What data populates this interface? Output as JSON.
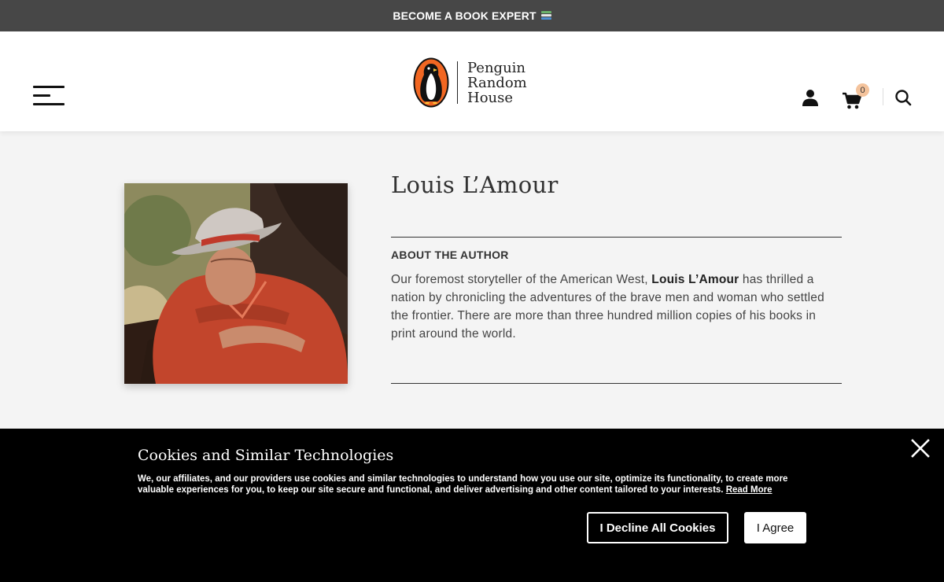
{
  "promo": {
    "text": "BECOME A BOOK EXPERT",
    "icon": "books-emoji-icon"
  },
  "header": {
    "logo_lines": [
      "Penguin",
      "Random",
      "House"
    ],
    "cart_count": "0",
    "colors": {
      "logo_orange": "#f26722",
      "badge": "#f4c39c"
    }
  },
  "author": {
    "name": "Louis L’Amour",
    "photo": "author-photo",
    "about_heading": "ABOUT THE AUTHOR",
    "about_pre": "Our foremost storyteller of the American West, ",
    "about_name": "Louis L’Amour",
    "about_post": " has thrilled a nation by chronicling the adventures of the brave men and woman who settled the frontier. There are more than three hundred million copies of his books in print around the world."
  },
  "cookie": {
    "title": "Cookies and Similar Technologies",
    "text": "We, our affiliates, and our providers use cookies and similar technologies to understand how you use our site, optimize its functionality, to create more valuable experiences for you, to keep our site secure and functional, and deliver advertising and other content tailored to your interests.",
    "read_more": "Read More",
    "decline_label": "I Decline All Cookies",
    "agree_label": "I Agree"
  }
}
